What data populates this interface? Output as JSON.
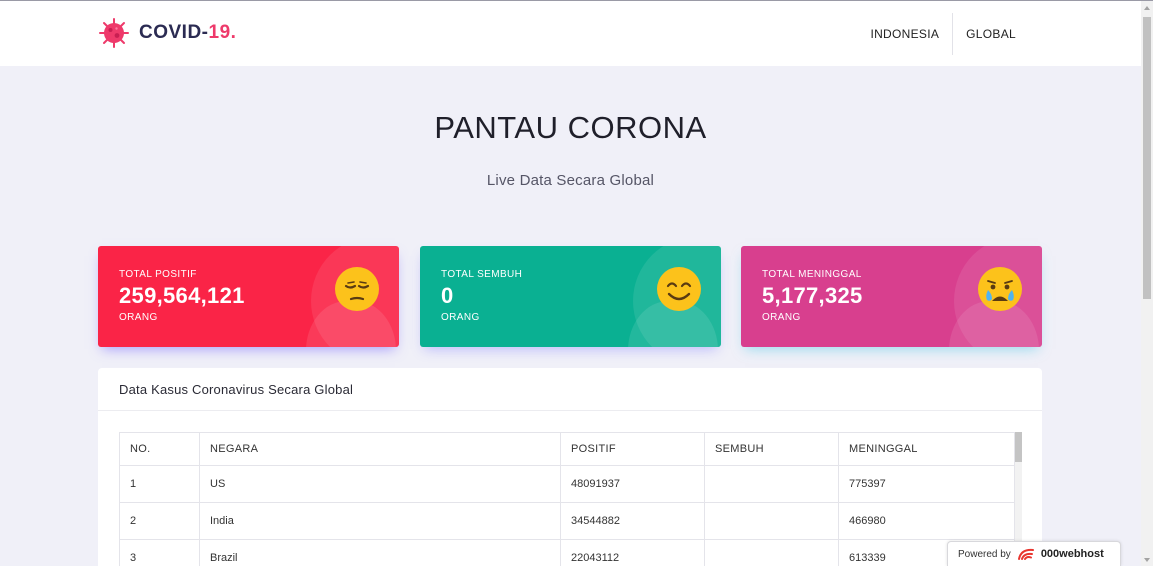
{
  "navbar": {
    "brand_main": "COVID-",
    "brand_accent": "19.",
    "links": [
      "INDONESIA",
      "GLOBAL"
    ]
  },
  "hero": {
    "title": "PANTAU CORONA",
    "subtitle": "Live Data Secara Global"
  },
  "cards": [
    {
      "label": "TOTAL POSITIF",
      "value": "259,564,121",
      "unit": "ORANG",
      "emoji": "unamused-face-icon",
      "color": "#fa2447"
    },
    {
      "label": "TOTAL SEMBUH",
      "value": "0",
      "unit": "ORANG",
      "emoji": "smiling-face-icon",
      "color": "#0ab092"
    },
    {
      "label": "TOTAL MENINGGAL",
      "value": "5,177,325",
      "unit": "ORANG",
      "emoji": "crying-face-icon",
      "color": "#d83f8e"
    }
  ],
  "table": {
    "title": "Data Kasus Coronavirus Secara Global",
    "headers": [
      "NO.",
      "NEGARA",
      "POSITIF",
      "SEMBUH",
      "MENINGGAL"
    ],
    "rows": [
      [
        "1",
        "US",
        "48091937",
        "",
        "775397"
      ],
      [
        "2",
        "India",
        "34544882",
        "",
        "466980"
      ],
      [
        "3",
        "Brazil",
        "22043112",
        "",
        "613339"
      ]
    ]
  },
  "badge": {
    "prefix": "Powered by",
    "host": "000webhost"
  }
}
